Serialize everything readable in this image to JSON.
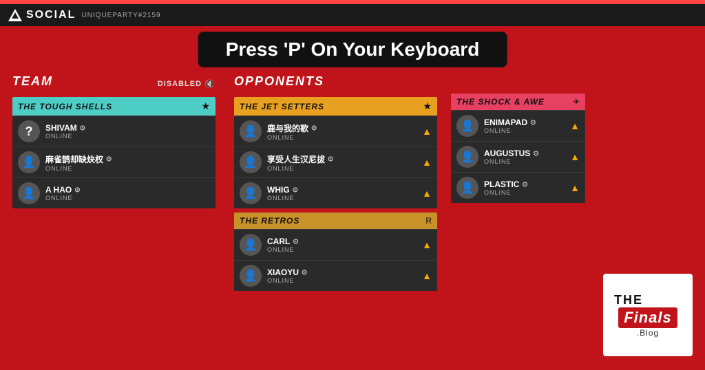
{
  "header": {
    "social_label": "SOCIAL",
    "party_id": "UNIQUEPARTY#2159"
  },
  "banner": {
    "text": "Press 'P' On Your Keyboard"
  },
  "team_section": {
    "label": "TEAM",
    "disabled_label": "DISABLED",
    "team_name": "THE TOUGH SHELLS",
    "players": [
      {
        "name": "SHIVAM",
        "status": "ONLINE",
        "avatar": "?"
      },
      {
        "name": "麻雀鹊却缺炔权",
        "status": "ONLINE",
        "avatar": "person"
      },
      {
        "name": "A HAO",
        "status": "ONLINE",
        "avatar": "person"
      }
    ]
  },
  "opponents_section": {
    "label": "OPPONENTS",
    "teams": [
      {
        "name": "THE JET SETTERS",
        "header_color": "orange",
        "players": [
          {
            "name": "鹿与我的歌",
            "status": "ONLINE"
          },
          {
            "name": "享受人生汉尼拔",
            "status": "ONLINE"
          },
          {
            "name": "WHIG",
            "status": "ONLINE"
          }
        ]
      },
      {
        "name": "THE RETROS",
        "header_color": "gold",
        "players": [
          {
            "name": "CARL",
            "status": "ONLINE"
          },
          {
            "name": "XIAOYU",
            "status": "ONLINE"
          }
        ]
      }
    ]
  },
  "third_section": {
    "team_name": "THE SHOCK & AWE",
    "header_color": "pink",
    "players": [
      {
        "name": "ENIMAPAD",
        "status": "ONLINE"
      },
      {
        "name": "AUGUSTUS",
        "status": "ONLINE"
      },
      {
        "name": "PLASTIC",
        "status": "ONLINE"
      }
    ]
  },
  "finals_blog": {
    "the": "THE",
    "finals": "Finals",
    "blog": ".Blog"
  }
}
